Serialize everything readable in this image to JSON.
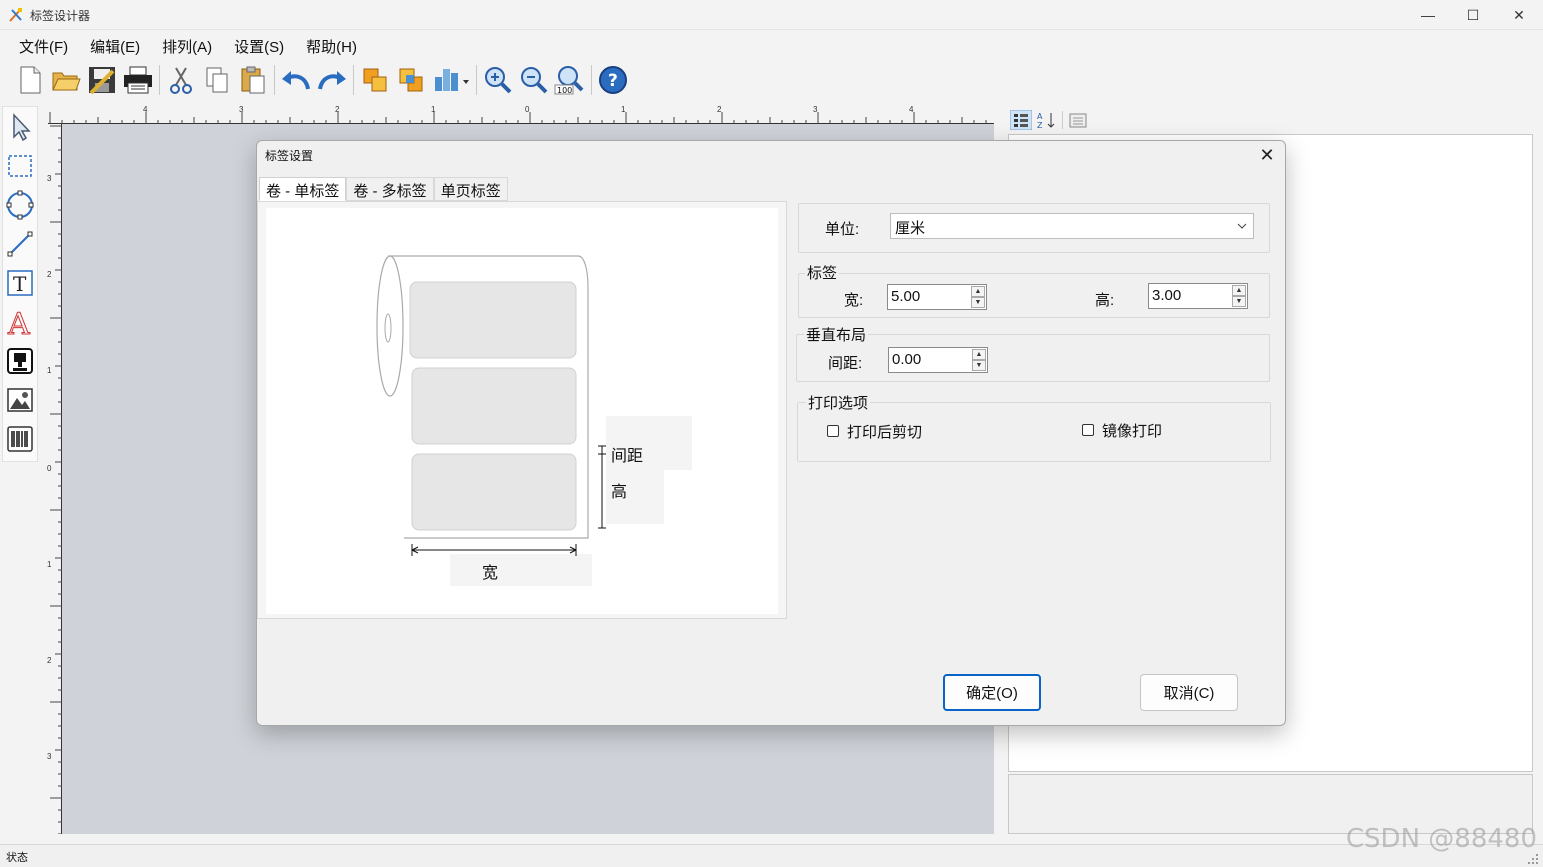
{
  "window": {
    "title": "标签设计器",
    "minimize": "—",
    "maximize": "☐",
    "close": "✕"
  },
  "menu": [
    "文件(F)",
    "编辑(E)",
    "排列(A)",
    "设置(S)",
    "帮助(H)"
  ],
  "toolbar": {
    "icons": [
      "new-file-icon",
      "open-folder-icon",
      "save-icon",
      "print-icon",
      "cut-icon",
      "copy-icon",
      "paste-icon",
      "undo-icon",
      "redo-icon",
      "bring-front-icon",
      "send-back-icon",
      "align-icon",
      "zoom-in-icon",
      "zoom-out-icon",
      "zoom-100-icon",
      "help-icon"
    ],
    "zoom100_text": "100",
    "help_glyph": "?"
  },
  "left_tools": [
    "select-arrow-icon",
    "rect-select-icon",
    "ellipse-icon",
    "line-icon",
    "text-box-icon",
    "font-a-icon",
    "stamp-icon",
    "image-icon",
    "barcode-icon"
  ],
  "left_tool_glyphs": {
    "text_box": "T",
    "font": "A"
  },
  "ruler": {
    "h_labels": [
      "4",
      "3",
      "2",
      "1",
      "0",
      "1",
      "2",
      "3",
      "4"
    ],
    "v_labels": [
      "3",
      "2",
      "1",
      "0",
      "1",
      "2",
      "3"
    ]
  },
  "dialog": {
    "title": "标签设置",
    "close": "✕",
    "tabs": [
      "卷 - 单标签",
      "卷 - 多标签",
      "单页标签"
    ],
    "active_tab": 0,
    "diagram": {
      "gap_label": "间距",
      "height_label": "高",
      "width_label": "宽"
    },
    "unit": {
      "label": "单位:",
      "value": "厘米"
    },
    "label_group": {
      "title": "标签",
      "width_label": "宽:",
      "width_value": "5.00",
      "height_label": "高:",
      "height_value": "3.00"
    },
    "vertical_group": {
      "title": "垂直布局",
      "gap_label": "间距:",
      "gap_value": "0.00"
    },
    "print_group": {
      "title": "打印选项",
      "cut_after_print": "打印后剪切",
      "mirror_print": "镜像打印",
      "cut_checked": false,
      "mirror_checked": false
    },
    "ok_button": "确定(O)",
    "cancel_button": "取消(C)"
  },
  "status": {
    "text": "状态"
  },
  "watermark": "CSDN @88480"
}
